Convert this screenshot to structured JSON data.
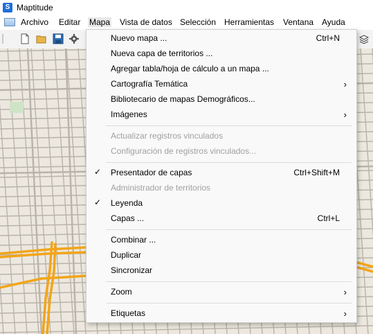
{
  "window": {
    "title": "Maptitude"
  },
  "menubar": {
    "items": [
      "Archivo",
      "Editar",
      "Mapa",
      "Vista de datos",
      "Selección",
      "Herramientas",
      "Ventana",
      "Ayuda"
    ]
  },
  "mapa_menu": {
    "items": [
      {
        "label": "Nuevo mapa ...",
        "shortcut": "Ctrl+N"
      },
      {
        "label": "Nueva capa de territorios ..."
      },
      {
        "label": "Agregar tabla/hoja de cálculo a un mapa ..."
      },
      {
        "label": "Cartografía Temática",
        "submenu": true
      },
      {
        "label": "Bibliotecario de mapas Demográficos..."
      },
      {
        "label": "Imágenes",
        "submenu": true
      },
      {
        "label": "Actualizar registros vinculados",
        "disabled": true
      },
      {
        "label": "Configuración de registros vinculados...",
        "disabled": true
      },
      {
        "label": "Presentador de capas",
        "shortcut": "Ctrl+Shift+M",
        "checked": true
      },
      {
        "label": "Administrador de territorios",
        "disabled": true
      },
      {
        "label": "Leyenda",
        "checked": true
      },
      {
        "label": "Capas ...",
        "shortcut": "Ctrl+L"
      },
      {
        "label": "Combinar ..."
      },
      {
        "label": "Duplicar"
      },
      {
        "label": "Sincronizar"
      },
      {
        "label": "Zoom",
        "submenu": true
      },
      {
        "label": "Etiquetas",
        "submenu": true
      }
    ]
  },
  "icons": {
    "check": "✓",
    "submenu_arrow": "›"
  },
  "colors": {
    "map_background": "#ece8df",
    "street": "#b9b3aa",
    "highway": "#f2a51a",
    "park": "#cfe3c6",
    "menu_background": "#f9f9f9",
    "disabled_text": "#a0a0a0"
  }
}
